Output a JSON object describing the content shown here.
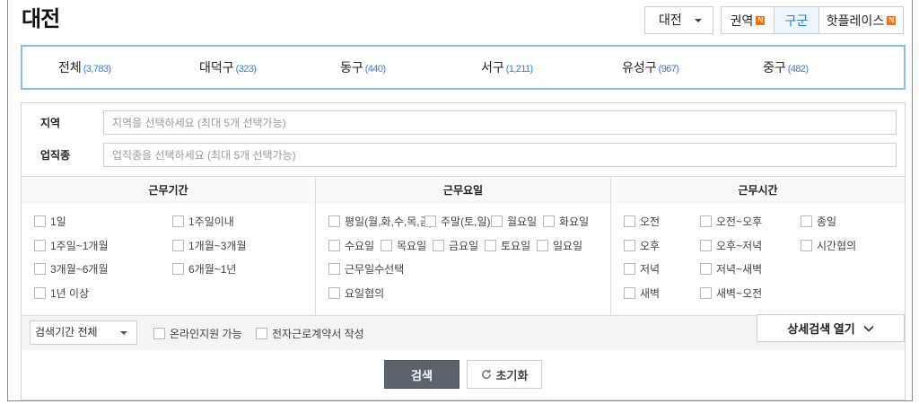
{
  "header": {
    "title": "대전",
    "city_select": {
      "value": "대전"
    },
    "view_tabs": [
      {
        "label": "권역",
        "badge": "N"
      },
      {
        "label": "구군",
        "selected": true
      },
      {
        "label": "핫플레이스",
        "badge": "N"
      }
    ]
  },
  "districts": [
    {
      "name": "전체",
      "count": "(3,783)"
    },
    {
      "name": "대덕구",
      "count": "(323)"
    },
    {
      "name": "동구",
      "count": "(440)"
    },
    {
      "name": "서구",
      "count": "(1,211)"
    },
    {
      "name": "유성구",
      "count": "(967)"
    },
    {
      "name": "중구",
      "count": "(482)"
    }
  ],
  "filters": {
    "region": {
      "label": "지역",
      "placeholder": "지역을 선택하세요 (최대 5개 선택가능)"
    },
    "job": {
      "label": "업직종",
      "placeholder": "업직종을 선택하세요 (최대 5개 선택가능)"
    }
  },
  "work_period": {
    "header": "근무기간",
    "rows": [
      [
        "1일",
        "1주일이내"
      ],
      [
        "1주일~1개월",
        "1개월~3개월"
      ],
      [
        "3개월~6개월",
        "6개월~1년"
      ],
      [
        "1년 이상"
      ]
    ]
  },
  "work_days": {
    "header": "근무요일",
    "rows": [
      [
        "평일(월,화,수,목,금)",
        "주말(토,일)",
        "월요일",
        "화요일"
      ],
      [
        "수요일",
        "목요일",
        "금요일",
        "토요일",
        "일요일"
      ],
      [
        "근무일수선택"
      ],
      [
        "요일협의"
      ]
    ]
  },
  "work_hours": {
    "header": "근무시간",
    "rows": [
      [
        "오전",
        "오전~오후",
        "종일"
      ],
      [
        "오후",
        "오후~저녁",
        "시간협의"
      ],
      [
        "저녁",
        "저녁~새벽"
      ],
      [
        "새벽",
        "새벽~오전"
      ]
    ]
  },
  "options_bar": {
    "period_select": {
      "value": "검색기간 전체"
    },
    "online_apply": "온라인지원 가능",
    "e_contract": "전자근로계약서 작성",
    "detail_toggle": "상세검색 열기"
  },
  "actions": {
    "search": "검색",
    "reset": "초기화"
  },
  "icons": {
    "city_select": "caret-down-icon",
    "period_select": "caret-down-icon",
    "detail_toggle": "chevron-down-icon",
    "reset": "refresh-icon",
    "tab_badge": "new-badge"
  },
  "colors": {
    "accent_blue": "#2f7bd8",
    "count_blue": "#3a7bd5",
    "district_border": "#8dbbe8",
    "badge_orange": "#ff6c0a",
    "search_button": "#5b646d",
    "options_bar_bg": "#f4f4f4"
  }
}
